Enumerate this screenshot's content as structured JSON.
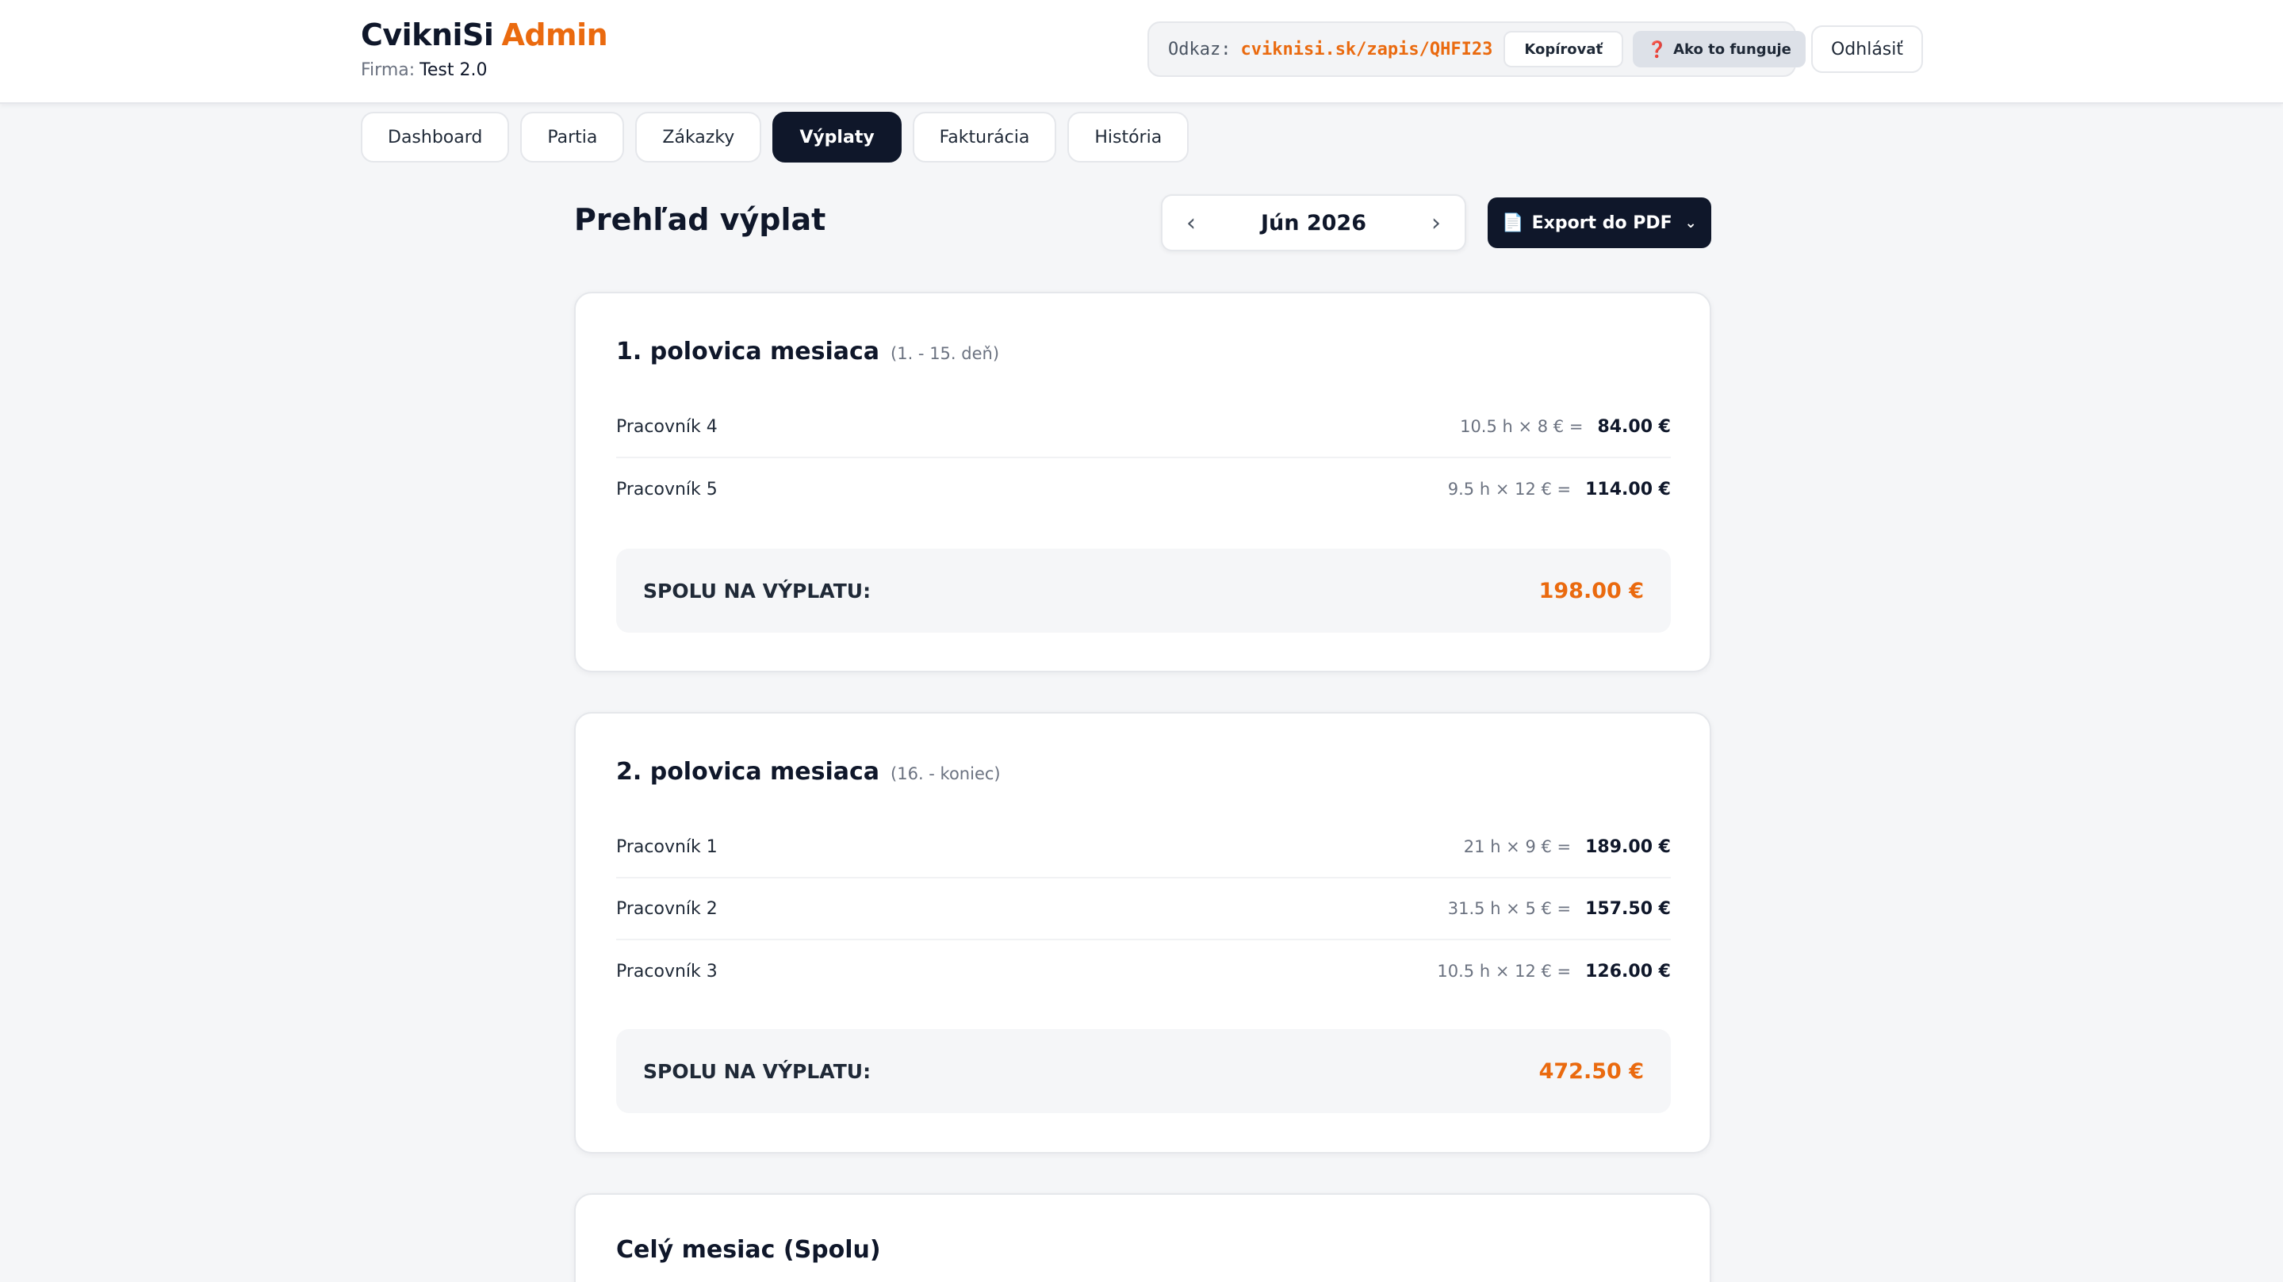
{
  "header": {
    "brand_main": "CvikniSi",
    "brand_accent": "Admin",
    "firm_label": "Firma:",
    "firm_name": "Test 2.0",
    "link_label": "Odkaz:",
    "link_url": "cviknisi.sk/zapis/QHFI23",
    "copy_label": "Kopírovať",
    "help_icon_glyph": "❓",
    "help_label": "Ako to funguje",
    "logout_label": "Odhlásiť"
  },
  "tabs": [
    {
      "label": "Dashboard",
      "active": false
    },
    {
      "label": "Partia",
      "active": false
    },
    {
      "label": "Zákazky",
      "active": false
    },
    {
      "label": "Výplaty",
      "active": true
    },
    {
      "label": "Fakturácia",
      "active": false
    },
    {
      "label": "História",
      "active": false
    }
  ],
  "page": {
    "title": "Prehľad výplat",
    "month": "Jún 2026",
    "prev_glyph": "‹",
    "next_glyph": "›",
    "export_label": "Export do PDF",
    "export_icon_glyph": "📄",
    "export_chevron_glyph": "⌄"
  },
  "sections": [
    {
      "title": "1. polovica mesiaca",
      "range": "(1. - 15. deň)",
      "rows": [
        {
          "name": "Pracovník 4",
          "calc": "10.5 h × 8 € =",
          "amount": "84.00 €"
        },
        {
          "name": "Pracovník 5",
          "calc": "9.5 h × 12 € =",
          "amount": "114.00 €"
        }
      ],
      "total_label": "SPOLU NA VÝPLATU:",
      "total_value": "198.00 €"
    },
    {
      "title": "2. polovica mesiaca",
      "range": "(16. - koniec)",
      "rows": [
        {
          "name": "Pracovník 1",
          "calc": "21 h × 9 € =",
          "amount": "189.00 €"
        },
        {
          "name": "Pracovník 2",
          "calc": "31.5 h × 5 € =",
          "amount": "157.50 €"
        },
        {
          "name": "Pracovník 3",
          "calc": "10.5 h × 12 € =",
          "amount": "126.00 €"
        }
      ],
      "total_label": "SPOLU NA VÝPLATU:",
      "total_value": "472.50 €"
    },
    {
      "title": "Celý mesiac (Spolu)"
    }
  ],
  "colors": {
    "accent": "#ea6a0f",
    "dark": "#0f172a",
    "background": "#f5f6f8"
  }
}
